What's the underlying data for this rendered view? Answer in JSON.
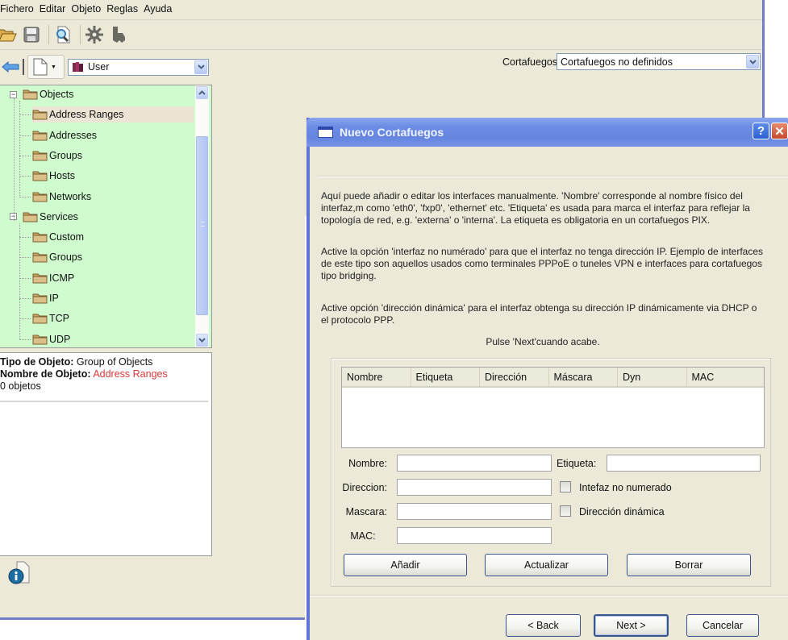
{
  "main_window": {
    "menu": [
      "Fichero",
      "Editar",
      "Objeto",
      "Reglas",
      "Ayuda"
    ],
    "toolbar": [
      {
        "name": "open-icon",
        "label": "Abrir"
      },
      {
        "name": "save-icon",
        "label": "Guardar"
      },
      {
        "name": "find-icon",
        "label": "Buscar"
      },
      {
        "name": "compile-icon",
        "label": "Compilar"
      },
      {
        "name": "install-icon",
        "label": "Instalar"
      }
    ],
    "library_select": {
      "value": "User"
    },
    "firewall_label": "Cortafuegos:",
    "firewall_select": {
      "value": "Cortafuegos no definidos"
    },
    "tree": [
      {
        "label": "Objects",
        "level": 0,
        "expanded": true
      },
      {
        "label": "Address Ranges",
        "level": 1,
        "selected": true
      },
      {
        "label": "Addresses",
        "level": 1
      },
      {
        "label": "Groups",
        "level": 1
      },
      {
        "label": "Hosts",
        "level": 1
      },
      {
        "label": "Networks",
        "level": 1
      },
      {
        "label": "Services",
        "level": 0,
        "expanded": true
      },
      {
        "label": "Custom",
        "level": 1
      },
      {
        "label": "Groups",
        "level": 1
      },
      {
        "label": "ICMP",
        "level": 1
      },
      {
        "label": "IP",
        "level": 1
      },
      {
        "label": "TCP",
        "level": 1
      },
      {
        "label": "UDP",
        "level": 1
      }
    ],
    "info": {
      "type_label": "Tipo de Objeto:",
      "type_value": "Group of Objects",
      "name_label": "Nombre de Objeto:",
      "name_value": "Address Ranges",
      "count": "0 objetos"
    }
  },
  "dialog": {
    "title": "Nuevo Cortafuegos",
    "help_button": "?",
    "close_button": "✕",
    "paragraphs": [
      "Aquí puede añadir o editar los interfaces manualmente. 'Nombre' corresponde al nombre físico del interfaz,m como 'eth0', 'fxp0', 'ethernet' etc. 'Etiqueta' es usada para marca el interfaz para reflejar la topología de red, e.g. 'externa' o 'interna'. La etiqueta es obligatoria en un cortafuegos PIX.",
      "Active la opción 'interfaz no numérado' para que el interfaz no tenga dirección IP. Ejemplo de interfaces de este tipo son aquellos usados como terminales PPPoE o tuneles VPN e interfaces para cortafuegos tipo bridging.",
      "Active opción 'dirección dinámica' para el interfaz obtenga su dirección IP dinámicamente via DHCP o el protocolo PPP.",
      "Pulse 'Next'cuando acabe."
    ],
    "table_columns": [
      "Nombre",
      "Etiqueta",
      "Dirección",
      "Máscara",
      "Dyn",
      "MAC"
    ],
    "table_rows": [],
    "fields": {
      "nombre": {
        "label": "Nombre:",
        "value": ""
      },
      "etiqueta": {
        "label": "Etiqueta:",
        "value": ""
      },
      "direccion": {
        "label": "Direccion:",
        "value": ""
      },
      "mascara": {
        "label": "Mascara:",
        "value": ""
      },
      "mac": {
        "label": "MAC:",
        "value": ""
      }
    },
    "checkboxes": {
      "unnumbered": {
        "label": "Intefaz no numerado",
        "checked": false
      },
      "dynamic": {
        "label": "Dirección dinámica",
        "checked": false
      }
    },
    "buttons": {
      "add": "Añadir",
      "update": "Actualizar",
      "delete": "Borrar",
      "back": "< Back",
      "next": "Next >",
      "cancel": "Cancelar"
    }
  },
  "colors": {
    "tree_background": "#cffbcf",
    "titlebar": "#6585e0",
    "window_frame": "#6f7dc9",
    "object_name": "#d83a3a"
  }
}
